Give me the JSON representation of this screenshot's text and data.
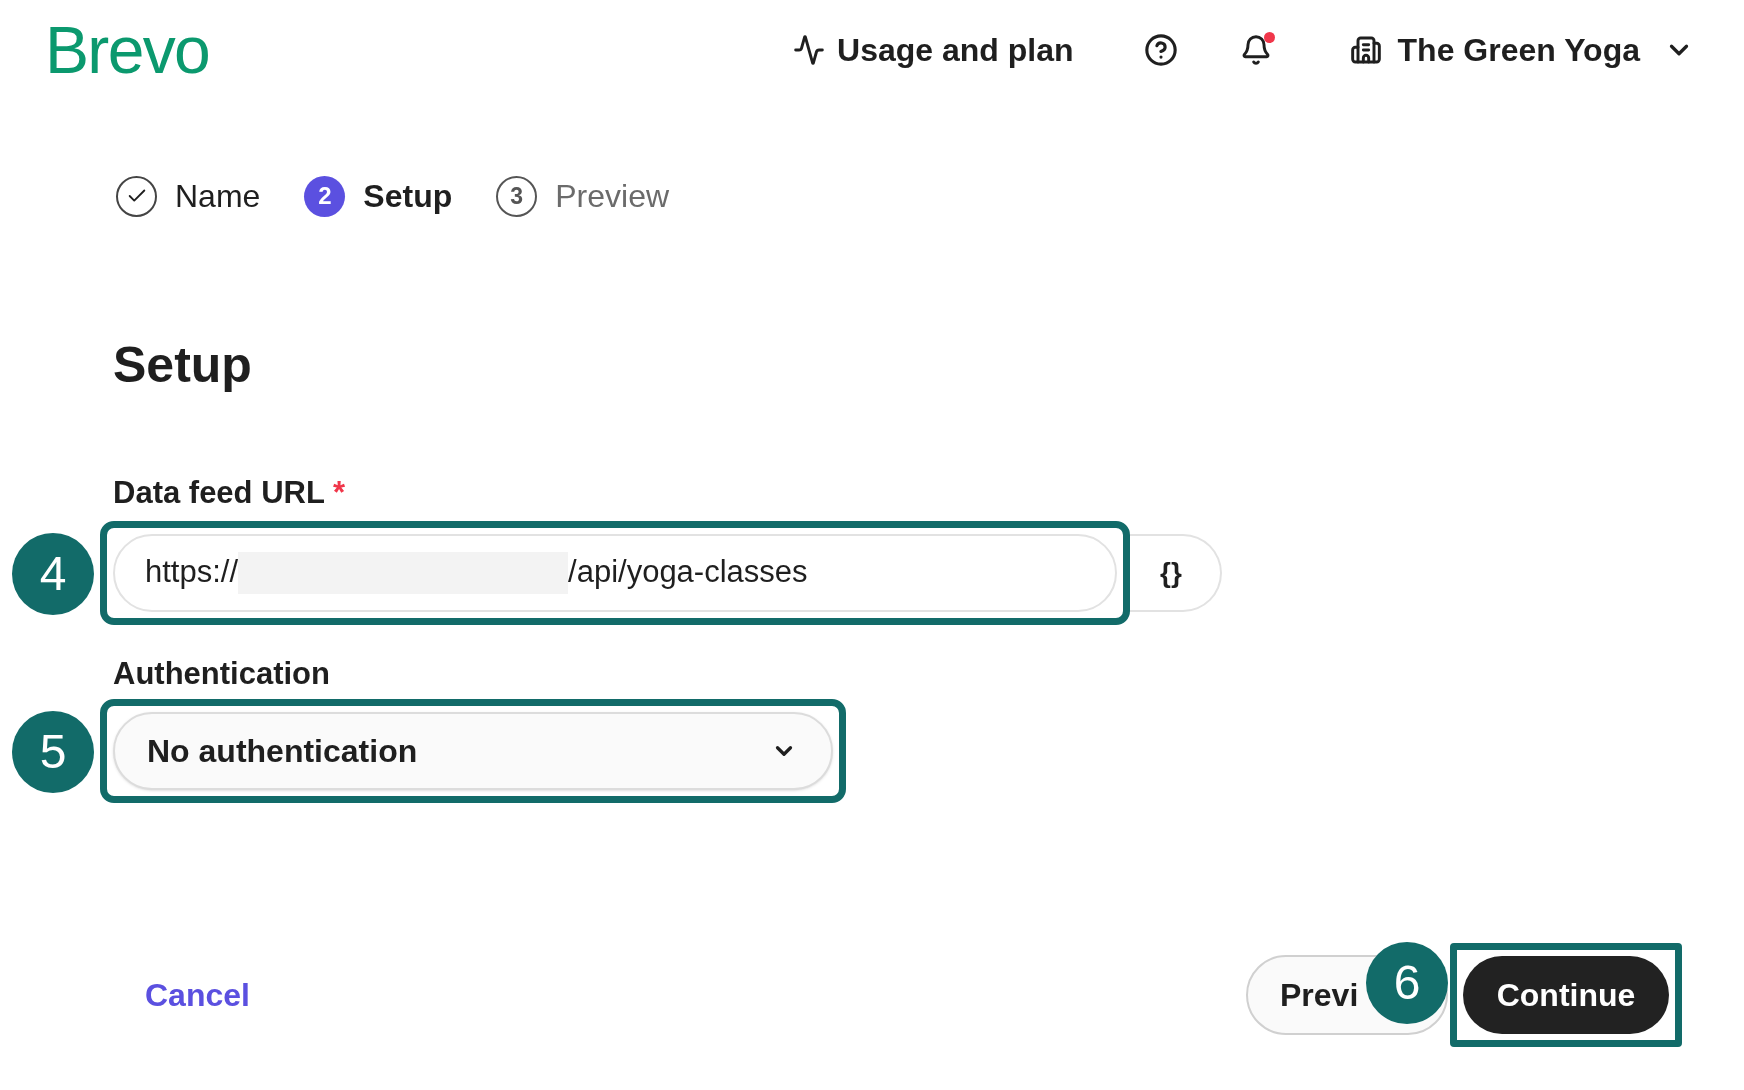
{
  "header": {
    "logo": "Brevo",
    "usage_link": "Usage and plan",
    "notifications_unread": true,
    "account": "The Green Yoga"
  },
  "steps": [
    {
      "kind": "done",
      "label": "Name",
      "selected": false
    },
    {
      "kind": "current",
      "marker": "2",
      "label": "Setup",
      "selected": true
    },
    {
      "kind": "upcoming",
      "marker": "3",
      "label": "Preview",
      "selected": false
    }
  ],
  "title": "Setup",
  "url_field": {
    "label": "Data feed URL",
    "required_mark": "*",
    "prefix": "https://",
    "path": "/api/yoga-classes",
    "braces_button": "{}",
    "callout": "4"
  },
  "auth_field": {
    "label": "Authentication",
    "value": "No authentication",
    "callout": "5"
  },
  "footer": {
    "cancel": "Cancel",
    "previous": "Previ",
    "continue": "Continue",
    "callout": "6"
  }
}
